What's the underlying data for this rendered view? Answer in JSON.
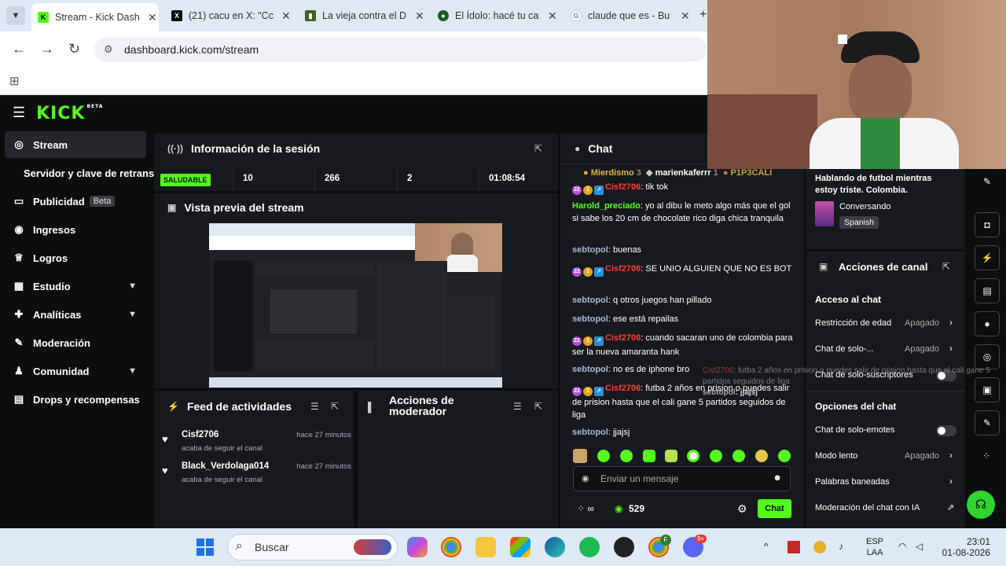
{
  "browser": {
    "tabs": [
      {
        "title": "Stream - Kick Dash",
        "color": "#53fc18",
        "glyph": "K",
        "active": true
      },
      {
        "title": "(21) cacu en X: \"Cc",
        "color": "#000000",
        "glyph": "X",
        "active": false
      },
      {
        "title": "La vieja contra el D",
        "color": "#3b5f2a",
        "glyph": "▮",
        "active": false
      },
      {
        "title": "El Ídolo: hacé tu ca",
        "color": "#1b5e20",
        "glyph": "●",
        "active": false
      },
      {
        "title": "claude que es - Bu",
        "color": "#4285f4",
        "glyph": "G",
        "active": false
      }
    ],
    "url": "dashboard.kick.com/stream"
  },
  "kick": {
    "logo": "KICK",
    "logo_badge": "BETA"
  },
  "sidebar": {
    "items": [
      {
        "label": "Stream",
        "icon": "((·))",
        "active": true,
        "chevron": false
      },
      {
        "label": "Servidor y clave de retransm",
        "icon": "",
        "active": false,
        "chevron": false
      },
      {
        "label": "Publicidad",
        "icon": "▭",
        "active": false,
        "chevron": false,
        "badge": "Beta"
      },
      {
        "label": "Ingresos",
        "icon": "◉",
        "active": false,
        "chevron": false
      },
      {
        "label": "Logros",
        "icon": "🏆",
        "active": false,
        "chevron": false
      },
      {
        "label": "Estudio",
        "icon": "▦",
        "active": false,
        "chevron": true
      },
      {
        "label": "Analíticas",
        "icon": "✚",
        "active": false,
        "chevron": true
      },
      {
        "label": "Moderación",
        "icon": "✎",
        "active": false,
        "chevron": false
      },
      {
        "label": "Comunidad",
        "icon": "♟",
        "active": false,
        "chevron": true
      },
      {
        "label": "Drops y recompensas",
        "icon": "▤",
        "active": false,
        "chevron": false
      }
    ]
  },
  "session": {
    "title": "Información de la sesión",
    "health": "SALUDABLE",
    "stats": [
      "10",
      "266",
      "2",
      "01:08:54"
    ]
  },
  "preview": {
    "title": "Vista previa del stream"
  },
  "feed": {
    "title": "Feed de actividades",
    "items": [
      {
        "name": "Cisf2706",
        "sub": "acaba de seguir el canal",
        "time": "hace 27 minutos"
      },
      {
        "name": "Black_Verdolaga014",
        "sub": "acaba de seguir el canal",
        "time": "hace 27 minutos"
      }
    ]
  },
  "modactions": {
    "title_line1": "Acciones de",
    "title_line2": "moderador"
  },
  "chat": {
    "title": "Chat",
    "top_gifters": [
      {
        "name": "Mierdismo",
        "count": "3"
      },
      {
        "name": "marienkaferrr",
        "count": "1"
      },
      {
        "name": "P1P3CALI",
        "count": ""
      }
    ],
    "messages": [
      {
        "user": "Cisf2706",
        "text": "tik tok",
        "color": "#ff3b3b",
        "badges": true
      },
      {
        "user": "Harold_preciado",
        "text": "yo al dibu le meto algo más que el gol si sabe los 20 cm de chocolate rico diga chica tranquila",
        "color": "#53fc18",
        "badges": false
      },
      {
        "user": "sebtopol",
        "text": "buenas",
        "color": "#a6b8d8",
        "badges": false
      },
      {
        "user": "Cisf2706",
        "text": "SE UNIO ALGUIEN QUE NO ES BOT",
        "color": "#ff3b3b",
        "badges": true
      },
      {
        "user": "sebtopol",
        "text": "q otros juegos han pillado",
        "color": "#a6b8d8",
        "badges": false
      },
      {
        "user": "sebtopol",
        "text": "ese está repailas",
        "color": "#a6b8d8",
        "badges": false
      },
      {
        "user": "Cisf2706",
        "text": "cuando sacaran uno de colombia para ser la nueva amaranta hank",
        "color": "#ff3b3b",
        "badges": true
      },
      {
        "user": "sebtopol",
        "text": "no es de iphone bro",
        "color": "#a6b8d8",
        "badges": false
      },
      {
        "user": "Cisf2706",
        "text": "futba 2 años en prision o puedes salir de prision hasta que el cali gane 5 partidos seguidos de liga",
        "color": "#ff3b3b",
        "badges": true
      },
      {
        "user": "sebtopol",
        "text": "jjajsj",
        "color": "#a6b8d8",
        "badges": false
      }
    ],
    "badge_num": "22",
    "placeholder": "Enviar un mensaje",
    "viewers": "529",
    "send_label": "Chat"
  },
  "overlay": {
    "line1_user": "Cisf2706",
    "line1_text": ": futba 2 años en prision o puedes salir de prision hasta que el cali",
    "line1_cont": "gane 5 partidos seguidos de liga",
    "line2_user": "sebtopol",
    "line2_text": ": jjajsj"
  },
  "stream_info": {
    "title": "Hablando de futbol mientras estoy triste. Colombia.",
    "category": "Conversando",
    "language": "Spanish"
  },
  "channel_actions": {
    "title": "Acciones de canal",
    "section1": "Acceso al chat",
    "rows1": [
      {
        "label": "Restricción de edad",
        "value": "Apagado",
        "type": "select"
      },
      {
        "label": "Chat de solo-...",
        "value": "Apagado",
        "type": "select"
      },
      {
        "label": "Chat de solo-suscriptores",
        "value": "",
        "type": "toggle"
      }
    ],
    "section2": "Opciones del chat",
    "rows2": [
      {
        "label": "Chat de solo-emotes",
        "value": "",
        "type": "toggle"
      },
      {
        "label": "Modo lento",
        "value": "Apagado",
        "type": "select"
      },
      {
        "label": "Palabras baneadas",
        "value": "",
        "type": "select"
      },
      {
        "label": "Moderación del chat con IA",
        "value": "",
        "type": "external"
      }
    ]
  },
  "taskbar": {
    "search_placeholder": "Buscar",
    "lang_line1": "ESP",
    "lang_line2": "LAA",
    "time": "23:01",
    "date": "01-08-2026",
    "discord_badge": "9+",
    "chrome_badge": "F"
  }
}
